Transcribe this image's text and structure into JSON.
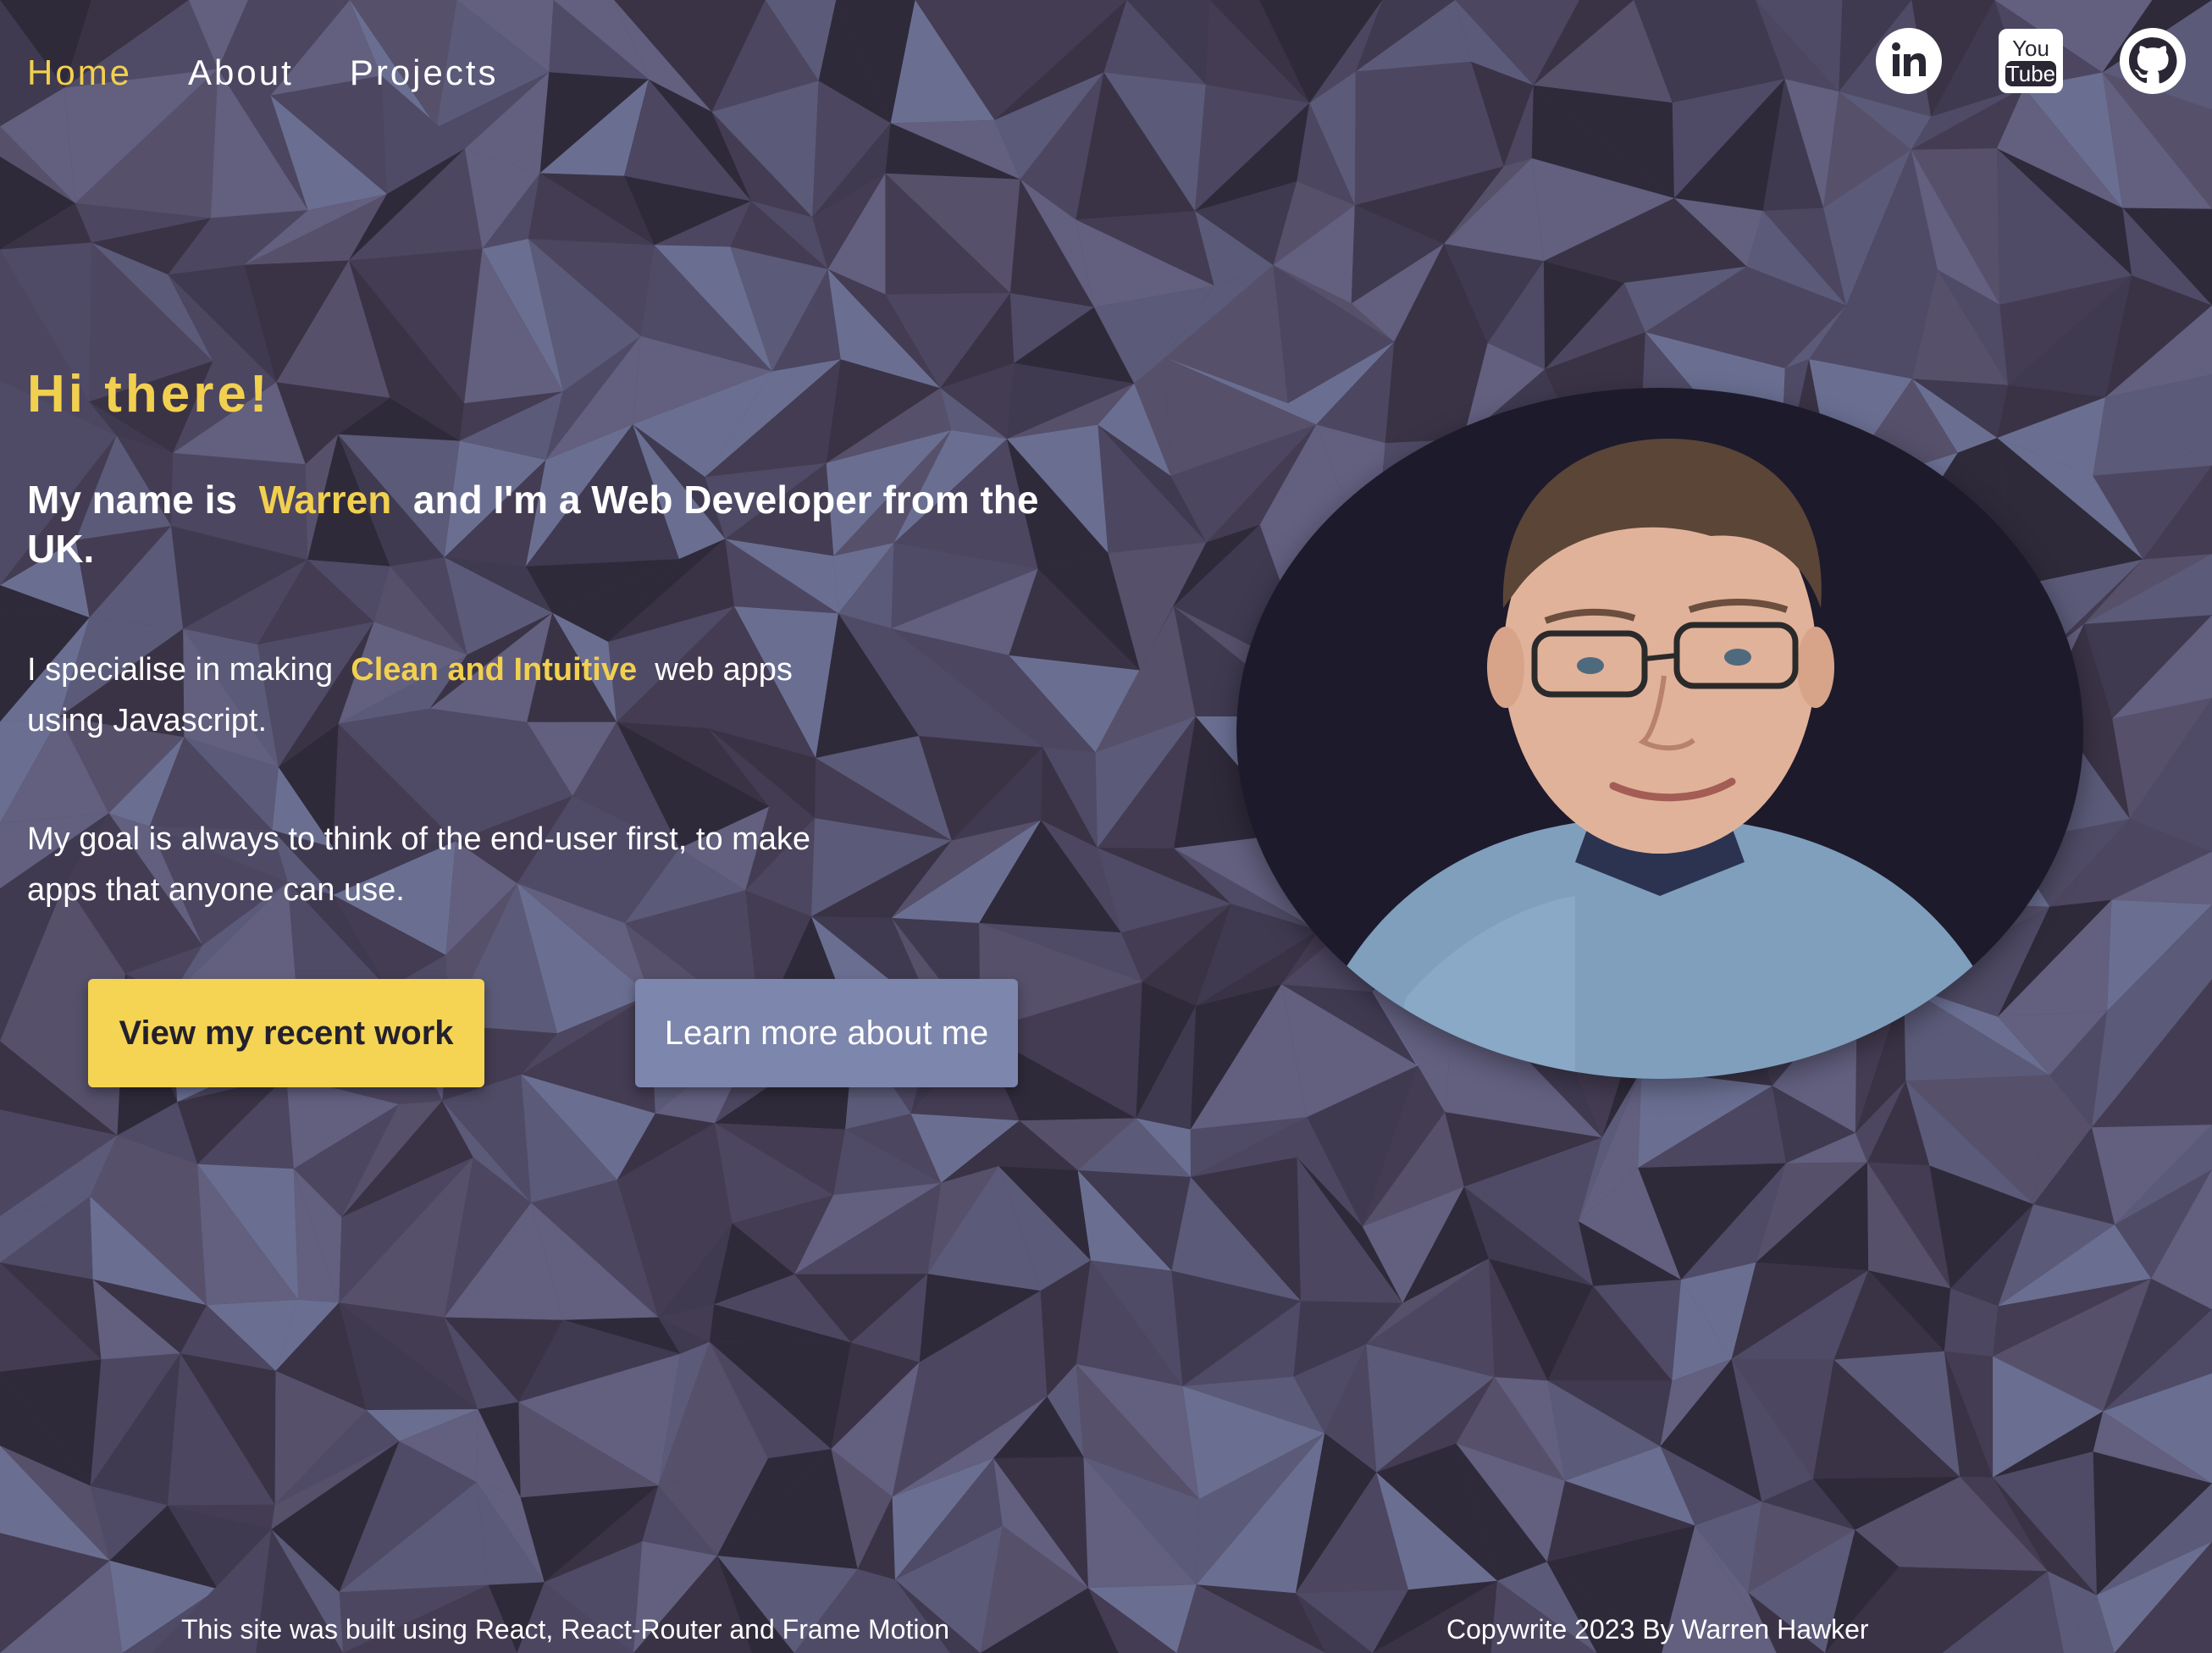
{
  "nav": {
    "items": [
      {
        "label": "Home",
        "active": true
      },
      {
        "label": "About",
        "active": false
      },
      {
        "label": "Projects",
        "active": false
      }
    ]
  },
  "socials": [
    {
      "icon": "linkedin-icon"
    },
    {
      "icon": "youtube-icon"
    },
    {
      "icon": "github-icon"
    }
  ],
  "hero": {
    "greeting": "Hi there!",
    "intro_prefix": "My name is",
    "name": "Warren",
    "intro_suffix": "and I'm a Web Developer from the UK.",
    "specialise_prefix": "I specialise in making",
    "specialise_highlight": "Clean and Intuitive",
    "specialise_suffix": "web apps using Javascript.",
    "goal": "My goal is always to think of the end-user first, to make apps that anyone can use."
  },
  "buttons": {
    "primary": "View my recent work",
    "secondary": "Learn more about me"
  },
  "footer": {
    "left": "This site was built using React, React-Router and Frame Motion",
    "right": "Copywrite 2023 By Warren Hawker"
  },
  "colors": {
    "accent": "#f2d04f",
    "button_primary": "#f4d452",
    "button_secondary": "#7d86ad",
    "background": "#4a4558"
  }
}
